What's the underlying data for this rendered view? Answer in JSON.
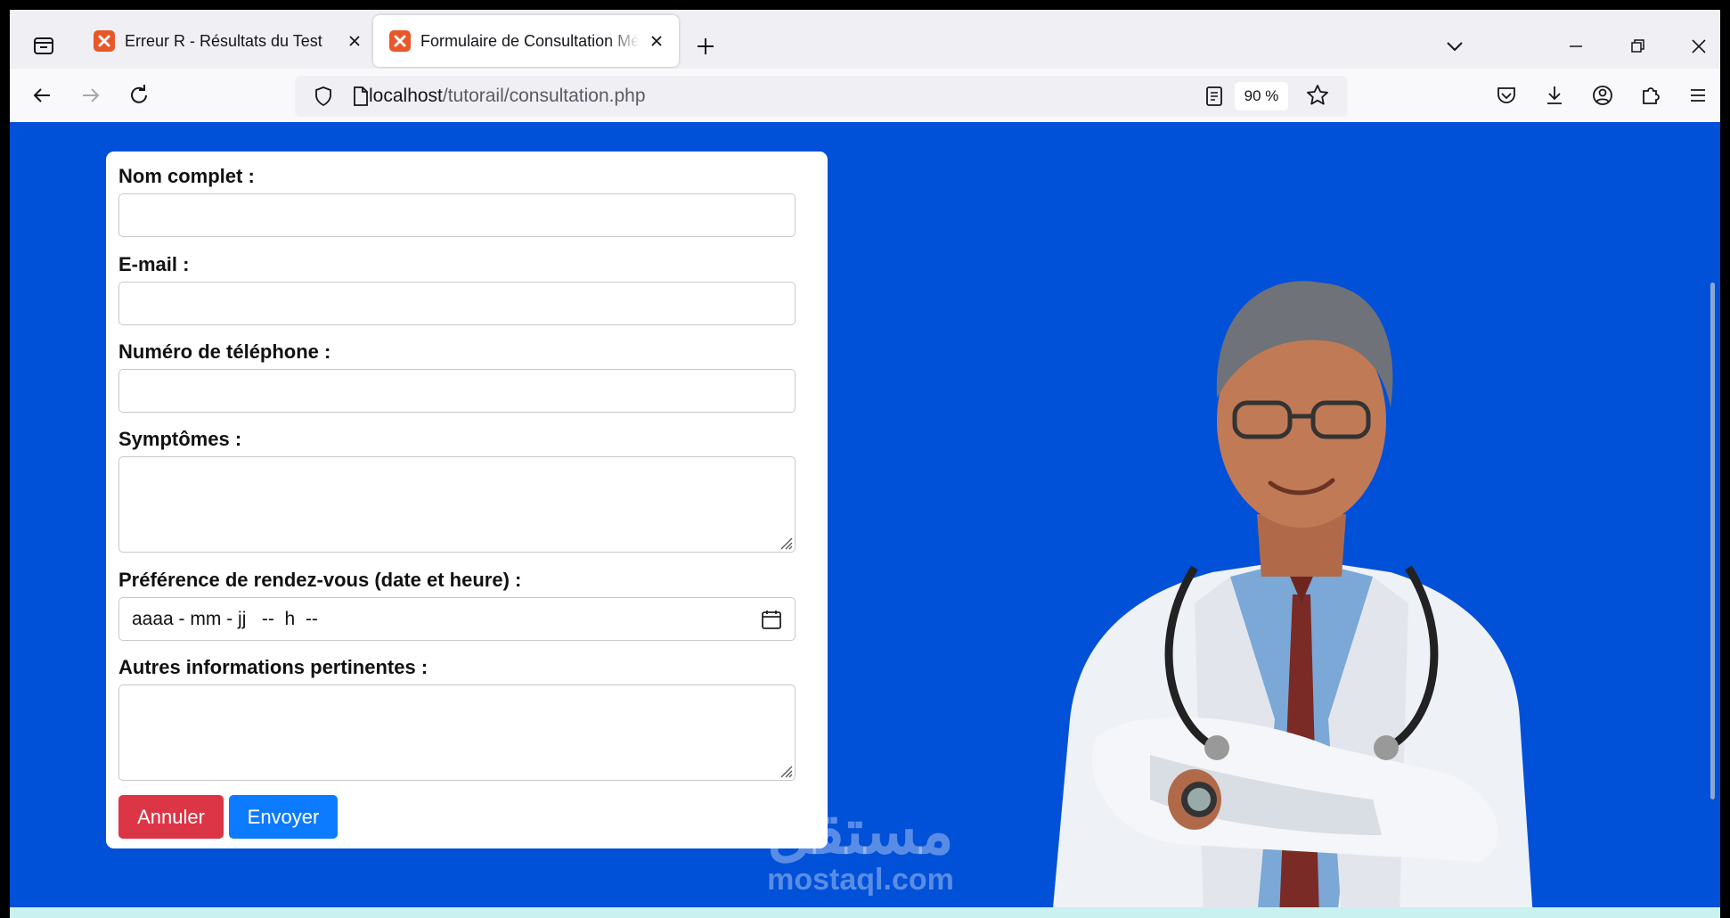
{
  "browser": {
    "tabs": [
      {
        "title": "Erreur R - Résultats du Test",
        "active": false
      },
      {
        "title": "Formulaire de Consultation Médicale",
        "active": true
      }
    ],
    "url": {
      "host": "localhost",
      "path": "/tutorail/consultation.php"
    },
    "zoom": "90 %"
  },
  "form": {
    "fields": {
      "name_label": "Nom complet :",
      "email_label": "E-mail :",
      "phone_label": "Numéro de téléphone :",
      "symptoms_label": "Symptômes :",
      "datetime_label": "Préférence de rendez-vous (date et heure) :",
      "datetime_value": "aaaa - mm - jj   --  h  --",
      "other_label": "Autres informations pertinentes :"
    },
    "buttons": {
      "cancel": "Annuler",
      "send": "Envoyer"
    }
  },
  "watermark": {
    "arabic": "مستقل",
    "latin": "mostaql.com"
  },
  "colors": {
    "page_background": "#0050d8",
    "cancel_button": "#dc3545",
    "send_button": "#0d7bff",
    "favicon": "#e8572a"
  }
}
